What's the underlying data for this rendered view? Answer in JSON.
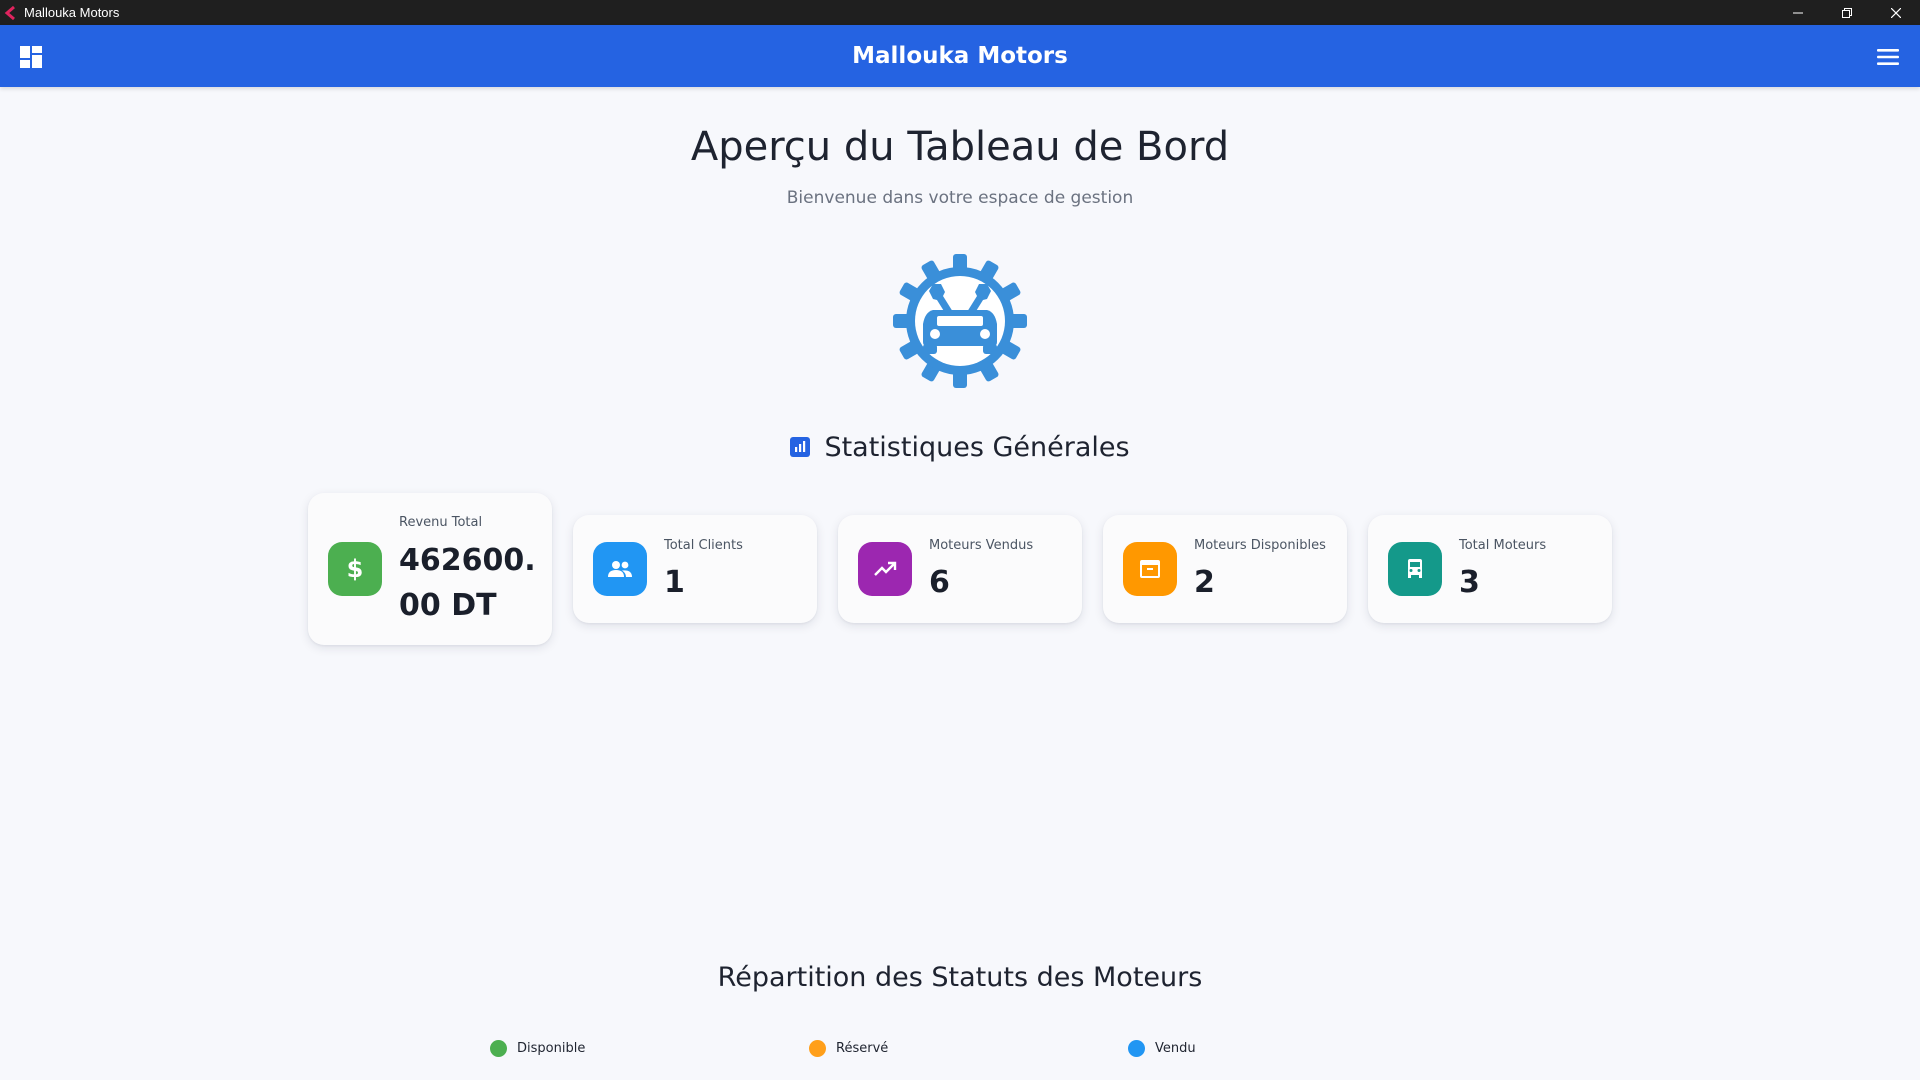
{
  "window": {
    "title": "Mallouka Motors"
  },
  "header": {
    "brand": "Mallouka Motors"
  },
  "page": {
    "title": "Aperçu du Tableau de Bord",
    "subtitle": "Bienvenue dans votre espace de gestion"
  },
  "stats_section": {
    "title": "Statistiques Générales"
  },
  "stats": [
    {
      "label": "Revenu Total",
      "value_line1": "462600.",
      "value_line2": "00 DT",
      "icon": "dollar-icon",
      "color": "#4caf50"
    },
    {
      "label": "Total Clients",
      "value": "1",
      "icon": "users-icon",
      "color": "#2196f3"
    },
    {
      "label": "Moteurs Vendus",
      "value": "6",
      "icon": "trending-up-icon",
      "color": "#9c27b0"
    },
    {
      "label": "Moteurs Disponibles",
      "value": "2",
      "icon": "archive-icon",
      "color": "#ff9800"
    },
    {
      "label": "Total Moteurs",
      "value": "3",
      "icon": "car-icon",
      "color": "#14998a"
    }
  ],
  "chart_data": {
    "title": "Répartition des Statuts des Moteurs",
    "legend": [
      {
        "label": "Disponible",
        "color": "#4caf50"
      },
      {
        "label": "Réservé",
        "color": "#ff9f1a"
      },
      {
        "label": "Vendu",
        "color": "#2196f3"
      }
    ]
  },
  "colors": {
    "primary": "#2563e2",
    "logo": "#3a8fd9"
  }
}
